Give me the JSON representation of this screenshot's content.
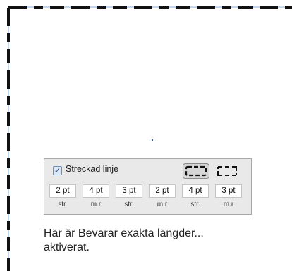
{
  "panel": {
    "checkbox": {
      "label": "Streckad linje",
      "checked": true
    },
    "style_options": [
      {
        "icon": "dashed-border-rounded-icon",
        "selected": true
      },
      {
        "icon": "dashed-border-square-icon",
        "selected": false
      }
    ],
    "fields": [
      {
        "value": "2 pt",
        "caption": "str."
      },
      {
        "value": "4 pt",
        "caption": "m.r"
      },
      {
        "value": "3 pt",
        "caption": "str."
      },
      {
        "value": "2 pt",
        "caption": "m.r"
      },
      {
        "value": "4 pt",
        "caption": "str."
      },
      {
        "value": "3 pt",
        "caption": "m.r"
      }
    ]
  },
  "description": {
    "line1": "Här är Bevarar exakta längder...",
    "line2": "aktiverat."
  },
  "colors": {
    "stroke": "#111111",
    "guide": "#7fb0e0"
  }
}
